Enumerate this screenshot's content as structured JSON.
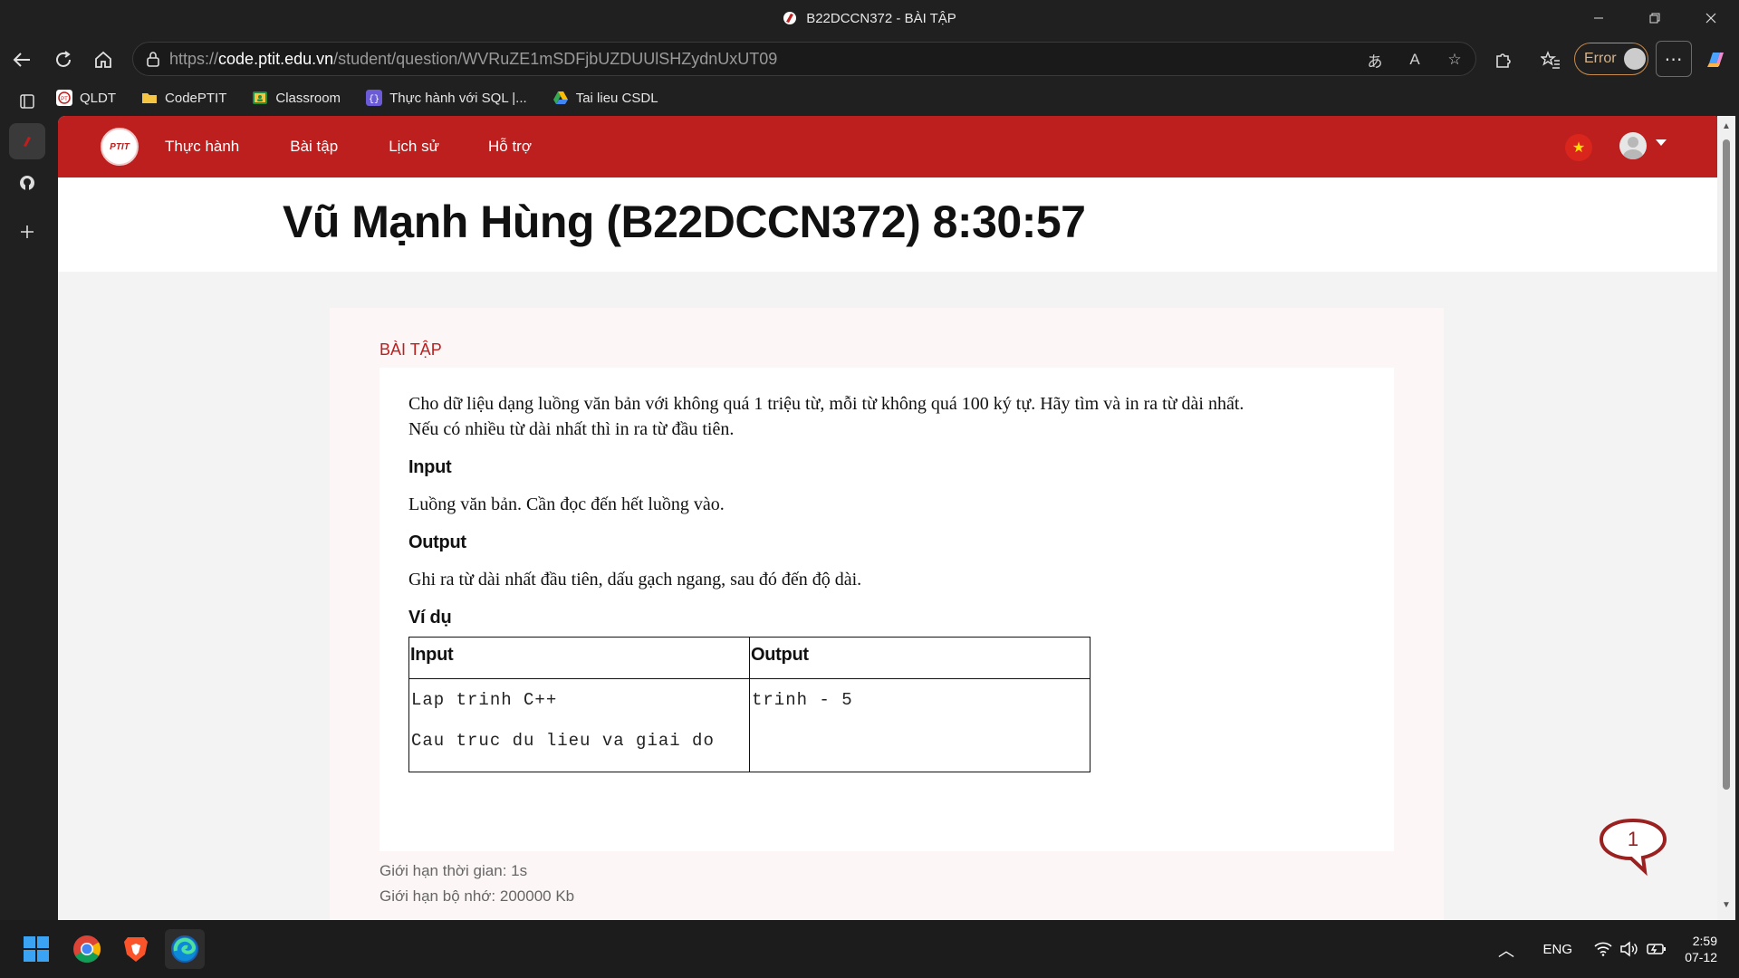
{
  "browser": {
    "tab_title": "B22DCCN372 - BÀI TẬP",
    "url_prefix": "https://",
    "url_host": "code.ptit.edu.vn",
    "url_path": "/student/question/WVRuZE1mSDFjbUZDUUlSHZydnUxUT09",
    "profile_status": "Error",
    "more_label": "⋯"
  },
  "bookmarks": [
    {
      "label": "QLDT",
      "icon": "ptit-favicon-icon"
    },
    {
      "label": "CodePTIT",
      "icon": "folder-icon"
    },
    {
      "label": "Classroom",
      "icon": "classroom-icon"
    },
    {
      "label": "Thực hành với SQL |...",
      "icon": "sql-icon"
    },
    {
      "label": "Tai lieu CSDL",
      "icon": "google-drive-icon"
    }
  ],
  "site": {
    "logo_text": "PTIT",
    "nav": [
      "Thực hành",
      "Bài tập",
      "Lịch sử",
      "Hỗ trợ"
    ],
    "user_title": "Vũ Mạnh Hùng (B22DCCN372)  8:30:57",
    "section_label": "BÀI TẬP"
  },
  "problem": {
    "statement": "Cho dữ liệu dạng luồng văn bản với không quá 1 triệu từ, mỗi từ không quá 100 ký tự. Hãy tìm và in ra từ dài nhất.",
    "statement2": "Nếu có nhiều từ dài nhất thì in ra từ đầu tiên.",
    "input_heading": "Input",
    "input_text": "Luồng văn bản. Cần đọc đến hết luồng vào.",
    "output_heading": "Output",
    "output_text": "Ghi ra từ dài nhất đầu tiên, dấu gạch ngang, sau đó đến độ dài.",
    "example_heading": "Ví dụ",
    "table": {
      "headers": [
        "Input",
        "Output"
      ],
      "input_lines": [
        "Lap trinh C++",
        "Cau truc du lieu va giai do"
      ],
      "output_lines": [
        "trinh - 5"
      ]
    },
    "time_limit": "Giới hạn thời gian: 1s",
    "memory_limit": "Giới hạn bộ nhớ: 200000 Kb"
  },
  "chat": {
    "badge": "1"
  },
  "taskbar": {
    "language": "ENG",
    "time": "2:59",
    "date": "07-12"
  },
  "colors": {
    "brand_red": "#bd1e1e",
    "browser_bg": "#202020"
  }
}
